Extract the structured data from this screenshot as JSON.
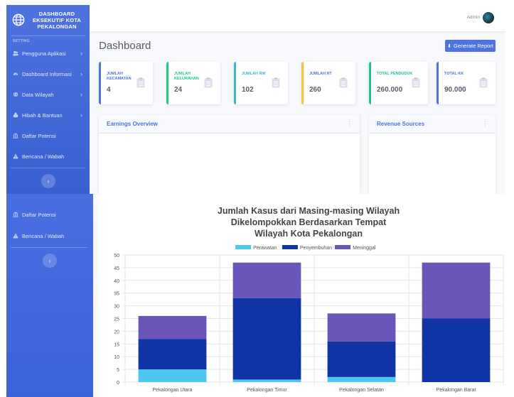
{
  "brand": {
    "line1": "DASHBOARD",
    "line2": "EKSEKUTIF KOTA",
    "line3": "PEKALONGAN",
    "icon": "globe-icon"
  },
  "sidebar": {
    "heading": "SETTING",
    "items": [
      {
        "label": "Pengguna Aplikasi",
        "icon": "users-icon",
        "chevron": "›"
      },
      {
        "label": "Dashboard Informasi",
        "icon": "dashboard-icon",
        "chevron": "›"
      },
      {
        "label": "Data Wilayah",
        "icon": "globe-icon",
        "chevron": "›"
      },
      {
        "label": "Hibah & Bantuan",
        "icon": "hand-icon",
        "chevron": "›"
      },
      {
        "label": "Daftar Potensi",
        "icon": "bank-icon"
      },
      {
        "label": "Bencana / Wabah",
        "icon": "warning-icon"
      }
    ],
    "toggle": "‹"
  },
  "topbar": {
    "user": "Admin"
  },
  "page": {
    "title": "Dashboard",
    "button": "Generate Report"
  },
  "cards": [
    {
      "label": "JUMLAH KECAMATAN",
      "value": "4",
      "color": "#4e73df"
    },
    {
      "label": "JUMLAH KELURAHAN",
      "value": "24",
      "color": "#1cc88a"
    },
    {
      "label": "JUMLAH RW",
      "value": "102",
      "color": "#36b9cc"
    },
    {
      "label": "JUMLAH RT",
      "value": "260",
      "color": "#f6c23e"
    },
    {
      "label": "TOTAL PENDUDUK",
      "value": "260.000",
      "color": "#1cc88a"
    },
    {
      "label": "TOTAL KK",
      "value": "90.000",
      "color": "#4e73df"
    }
  ],
  "panels": {
    "earnings": "Earnings Overview",
    "revenue": "Revenue Sources",
    "menu": "⋮"
  },
  "sidebar_bottom": {
    "items": [
      {
        "label": "Daftar Potensi",
        "icon": "bank-icon"
      },
      {
        "label": "Bencana / Wabah",
        "icon": "warning-icon"
      }
    ],
    "toggle": "‹"
  },
  "chart_data": {
    "type": "bar",
    "stacked": true,
    "title": [
      "Jumlah Kasus dari Masing-masing Wilayah",
      "Dikelompokkan Berdasarkan Tempat",
      "Wilayah Kota Pekalongan"
    ],
    "categories": [
      "Pekalongan Utara",
      "Pekalongan Timur",
      "Pekalongan Selatan",
      "Pekalongan Barat"
    ],
    "series": [
      {
        "name": "Perawatan",
        "values": [
          5,
          1,
          2,
          0
        ],
        "color": "#4cc7ef"
      },
      {
        "name": "Penyembuhan",
        "values": [
          12,
          32,
          14,
          25
        ],
        "color": "#1033a6"
      },
      {
        "name": "Meninggal",
        "values": [
          9,
          14,
          11,
          22
        ],
        "color": "#6a55b8"
      }
    ],
    "ylim": [
      0,
      50
    ],
    "yticks": [
      "0",
      "5",
      "10",
      "15",
      "20",
      "25",
      "30",
      "35",
      "40",
      "45",
      "50"
    ],
    "legend": "top",
    "grid": true
  }
}
